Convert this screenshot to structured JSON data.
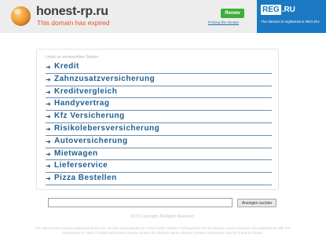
{
  "header": {
    "domain": "honest-rp.ru",
    "expired_text": "This domain has expired",
    "renew_button": "Renew",
    "renew_link": "Prolong the domain",
    "registrar_logo_main": "REG",
    "registrar_logo_suffix": ".RU",
    "registrar_text": "The domain is registered in REG.RU",
    "colors": {
      "accent_red": "#e8502e",
      "renew_green": "#3cae3a",
      "registrar_blue": "#1a79c2"
    }
  },
  "links": {
    "title": "Links zu verwandten Seiten",
    "arrow_icon": "arrow-right-icon",
    "items": [
      "Kredit",
      "Zahnzusatzversicherung",
      "Kreditvergleich",
      "Handyvertrag",
      "Kfz Versicherung",
      "Risikolebersversicherung",
      "Autoversicherung",
      "Mietwagen",
      "Lieferservice",
      "Pizza Bestellen"
    ]
  },
  "search": {
    "value": "",
    "button_label": "Anzeigen suchen"
  },
  "footer": {
    "copyright": "2015 Copyright. All Rights Reserved.",
    "disclaimer": "The Sponsored Listings displayed above are served automatically by a third party. Neither ParkingCrew nor the domain owner maintain any relationship with the advertisers. In case of trademark issues please contact the domain owner directly (contact information can be found in whois)."
  }
}
